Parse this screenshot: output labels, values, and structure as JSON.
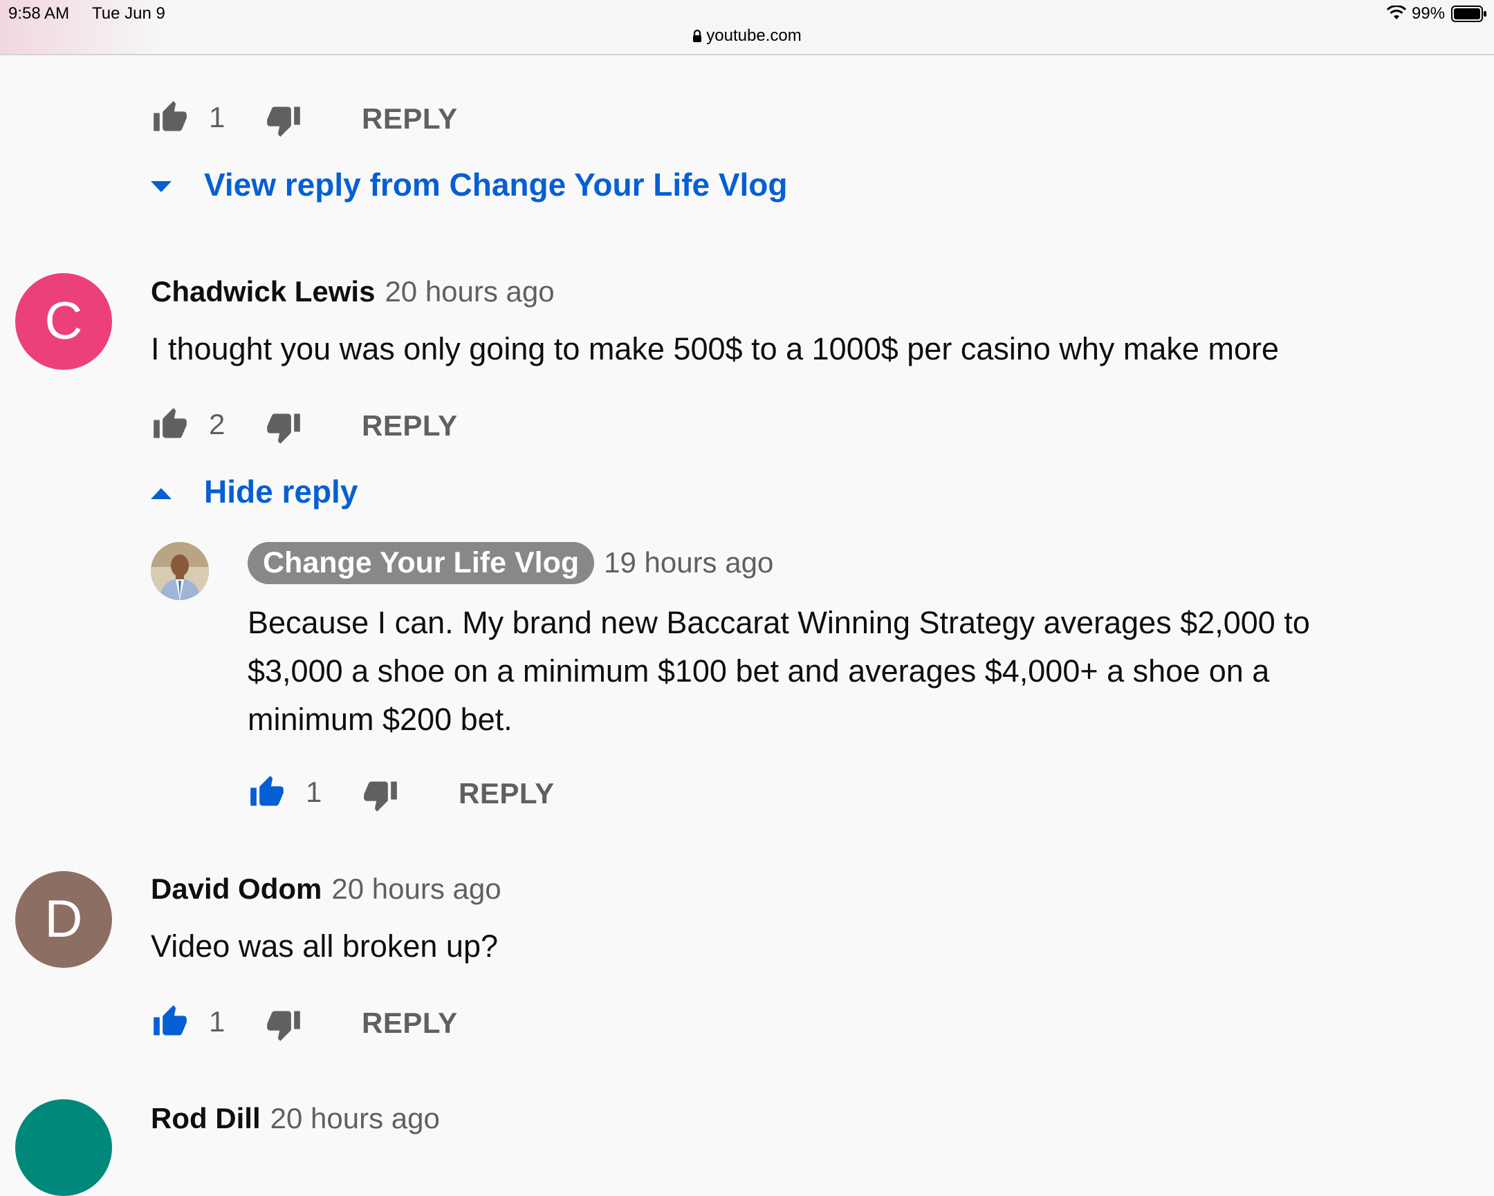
{
  "status_bar": {
    "time": "9:58 AM",
    "date": "Tue Jun 9",
    "battery": "99%"
  },
  "browser": {
    "url": "youtube.com"
  },
  "colors": {
    "link": "#065fd4",
    "liked": "#065fd4",
    "muted": "#606060",
    "avatar_c": "#ec407a",
    "avatar_d": "#8d6e63",
    "avatar_r": "#00897b"
  },
  "top_comment": {
    "likes": "1",
    "reply_label": "REPLY",
    "view_reply_label": "View reply from Change Your Life Vlog"
  },
  "comments": [
    {
      "avatar_letter": "C",
      "author": "Chadwick Lewis",
      "time": "20 hours ago",
      "text": "I thought you was only going to make 500$ to a 1000$ per casino why make more",
      "likes": "2",
      "reply_label": "REPLY",
      "toggle_label": "Hide reply",
      "replies": [
        {
          "author": "Change Your Life Vlog",
          "time": "19 hours ago",
          "text_lines": [
            "Because I can. My brand new Baccarat Winning Strategy averages $2,000 to",
            "$3,000 a shoe on a minimum $100 bet and averages $4,000+ a shoe on a",
            "minimum $200 bet."
          ],
          "likes": "1",
          "reply_label": "REPLY"
        }
      ]
    },
    {
      "avatar_letter": "D",
      "author": "David Odom",
      "time": "20 hours ago",
      "text": "Video was all broken up?",
      "likes": "1",
      "reply_label": "REPLY"
    },
    {
      "author": "Rod Dill",
      "time": "20 hours ago"
    }
  ],
  "icons": [
    "lock-icon",
    "wifi-icon",
    "battery-icon",
    "thumbs-up-icon",
    "thumbs-down-icon",
    "caret-down-icon",
    "caret-up-icon"
  ]
}
